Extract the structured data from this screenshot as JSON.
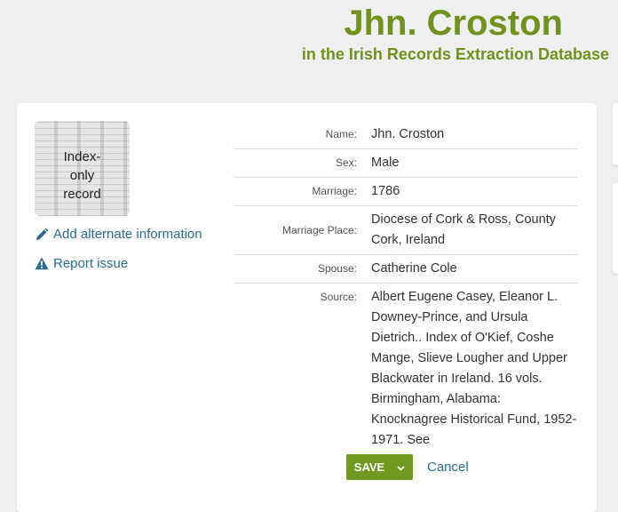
{
  "header": {
    "name": "Jhn. Croston",
    "subtitle": "in the Irish Records Extraction Database"
  },
  "thumbnail": {
    "label": "Index-only record"
  },
  "links": {
    "add_alternate": "Add alternate information",
    "report_issue": "Report issue"
  },
  "fields": [
    {
      "label": "Name:",
      "value": "Jhn. Croston"
    },
    {
      "label": "Sex:",
      "value": "Male"
    },
    {
      "label": "Marriage:",
      "value": "1786"
    },
    {
      "label": "Marriage Place:",
      "value": "Diocese of Cork & Ross, County Cork, Ireland"
    },
    {
      "label": "Spouse:",
      "value": "Catherine Cole"
    },
    {
      "label": "Source:",
      "value": "Albert Eugene Casey, Eleanor L. Downey-Prince, and Ursula Dietrich.. Index of O'Kief, Coshe Mange, Slieve Lougher and Upper Blackwater in Ireland. 16 vols. Birmingham, Alabama: Knocknagree Historical Fund, 1952-1971. See"
    }
  ],
  "actions": {
    "save_label": "SAVE",
    "cancel_label": "Cancel"
  },
  "colors": {
    "accent_green": "#6f921c",
    "link_blue": "#2a6b8f",
    "save_green": "#6f9a1f"
  },
  "icons": {
    "add_alternate": "pencil-icon",
    "report_issue": "warning-icon",
    "save_dropdown": "chevron-down-icon"
  }
}
